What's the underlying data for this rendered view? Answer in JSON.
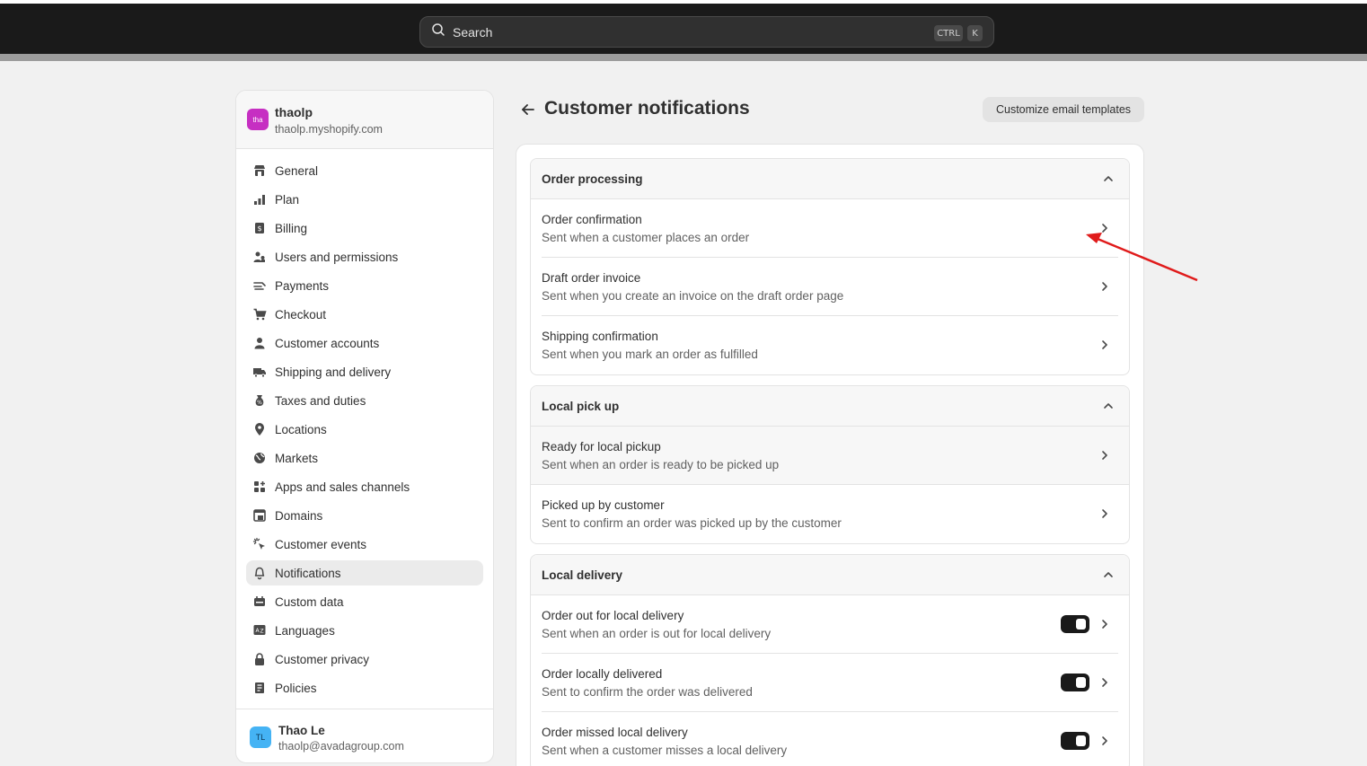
{
  "topbar": {
    "search_placeholder": "Search",
    "shortcut_ctrl": "CTRL",
    "shortcut_key": "K"
  },
  "store": {
    "logo_text": "tha",
    "name": "thaolp",
    "domain": "thaolp.myshopify.com"
  },
  "sidebar": {
    "items": [
      {
        "label": "General",
        "icon": "store-icon"
      },
      {
        "label": "Plan",
        "icon": "plan-icon"
      },
      {
        "label": "Billing",
        "icon": "billing-icon"
      },
      {
        "label": "Users and permissions",
        "icon": "users-icon"
      },
      {
        "label": "Payments",
        "icon": "payments-icon"
      },
      {
        "label": "Checkout",
        "icon": "cart-icon"
      },
      {
        "label": "Customer accounts",
        "icon": "person-icon"
      },
      {
        "label": "Shipping and delivery",
        "icon": "truck-icon"
      },
      {
        "label": "Taxes and duties",
        "icon": "tax-icon"
      },
      {
        "label": "Locations",
        "icon": "location-pin-icon"
      },
      {
        "label": "Markets",
        "icon": "globe-icon"
      },
      {
        "label": "Apps and sales channels",
        "icon": "apps-icon"
      },
      {
        "label": "Domains",
        "icon": "domains-icon"
      },
      {
        "label": "Customer events",
        "icon": "cursor-click-icon"
      },
      {
        "label": "Notifications",
        "icon": "bell-icon"
      },
      {
        "label": "Custom data",
        "icon": "custom-data-icon"
      },
      {
        "label": "Languages",
        "icon": "language-icon"
      },
      {
        "label": "Customer privacy",
        "icon": "lock-icon"
      },
      {
        "label": "Policies",
        "icon": "policies-icon"
      }
    ],
    "active_item": "Notifications"
  },
  "user": {
    "initials": "TL",
    "name": "Thao Le",
    "email": "thaolp@avadagroup.com"
  },
  "main": {
    "title": "Customer notifications",
    "customize_button": "Customize email templates",
    "groups": [
      {
        "title": "Order processing",
        "rows": [
          {
            "title": "Order confirmation",
            "subtitle": "Sent when a customer places an order"
          },
          {
            "title": "Draft order invoice",
            "subtitle": "Sent when you create an invoice on the draft order page"
          },
          {
            "title": "Shipping confirmation",
            "subtitle": "Sent when you mark an order as fulfilled"
          }
        ]
      },
      {
        "title": "Local pick up",
        "rows": [
          {
            "title": "Ready for local pickup",
            "subtitle": "Sent when an order is ready to be picked up"
          },
          {
            "title": "Picked up by customer",
            "subtitle": "Sent to confirm an order was picked up by the customer"
          }
        ]
      },
      {
        "title": "Local delivery",
        "rows": [
          {
            "title": "Order out for local delivery",
            "subtitle": "Sent when an order is out for local delivery",
            "enabled": true
          },
          {
            "title": "Order locally delivered",
            "subtitle": "Sent to confirm the order was delivered",
            "enabled": true
          },
          {
            "title": "Order missed local delivery",
            "subtitle": "Sent when a customer misses a local delivery",
            "enabled": true
          }
        ]
      }
    ]
  },
  "colors": {
    "topbar": "#1a1a1a",
    "background": "#f1f1f1",
    "store_logo": "#c62fc2",
    "avatar": "#45b3f4",
    "annotation_arrow": "#e01b1b",
    "toggle_on": "#1a1a1a"
  }
}
